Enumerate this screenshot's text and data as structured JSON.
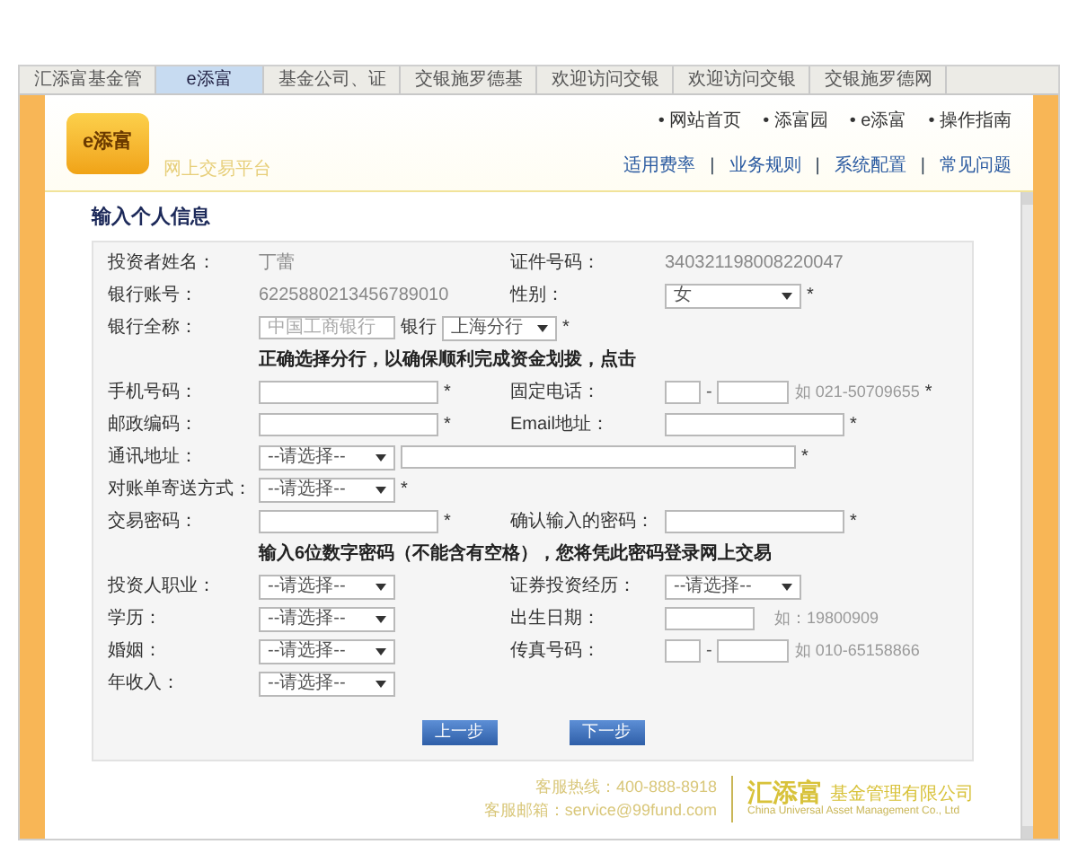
{
  "browser_tabs": [
    {
      "label": "汇添富基金管",
      "selected": false
    },
    {
      "label": "e添富",
      "selected": true
    },
    {
      "label": "基金公司、证",
      "selected": false
    },
    {
      "label": "交银施罗德基",
      "selected": false
    },
    {
      "label": "欢迎访问交银",
      "selected": false
    },
    {
      "label": "欢迎访问交银",
      "selected": false
    },
    {
      "label": "交银施罗德网",
      "selected": false
    }
  ],
  "header": {
    "logo": "e添富",
    "subtitle": "网上交易平台",
    "nav": [
      "• 网站首页",
      "• 添富园",
      "• e添富",
      "• 操作指南"
    ],
    "links": [
      {
        "kind": "link",
        "text": "适用费率"
      },
      {
        "kind": "sep",
        "text": "|"
      },
      {
        "kind": "link",
        "text": "业务规则"
      },
      {
        "kind": "sep",
        "text": "|"
      },
      {
        "kind": "link",
        "text": "系统配置"
      },
      {
        "kind": "sep",
        "text": "|"
      },
      {
        "kind": "link",
        "text": "常见问题"
      }
    ]
  },
  "form": {
    "title": "输入个人信息",
    "rows": [
      {
        "kind": "pair",
        "left": {
          "label": "投资者姓名：",
          "control": {
            "kind": "text",
            "value": "丁蕾"
          }
        },
        "right": {
          "label": "证件号码：",
          "control": {
            "kind": "text",
            "value": "340321198008220047"
          }
        }
      },
      {
        "kind": "pair",
        "left": {
          "label": "银行账号：",
          "control": {
            "kind": "text",
            "value": "6225880213456789010"
          }
        },
        "right": {
          "label": "性别：",
          "control": {
            "kind": "select",
            "value": "女"
          },
          "star": "*"
        }
      },
      {
        "kind": "wide",
        "field": {
          "label": "银行全称：",
          "control": {
            "kind": "bank",
            "placeholder": "中国工商银行",
            "text": "银行",
            "value": "上海分行"
          },
          "star": "*"
        }
      },
      {
        "kind": "note",
        "text": "正确选择分行，以确保顺利完成资金划拨，点击"
      },
      {
        "kind": "pair",
        "left": {
          "label": "手机号码：",
          "control": {
            "kind": "input"
          },
          "star": "*"
        },
        "right": {
          "label": "固定电话：",
          "control": {
            "kind": "phone",
            "separator": "-",
            "hint": "如 021-50709655"
          },
          "star": "*"
        }
      },
      {
        "kind": "pair",
        "left": {
          "label": "邮政编码：",
          "control": {
            "kind": "input"
          },
          "star": "*"
        },
        "right": {
          "label": "Email地址：",
          "control": {
            "kind": "input"
          },
          "star": "*"
        }
      },
      {
        "kind": "wide",
        "field": {
          "label": "通讯地址：",
          "control": {
            "kind": "address",
            "value": "--请选择--"
          },
          "star": "*"
        }
      },
      {
        "kind": "wide",
        "field": {
          "label": "对账单寄送方式：",
          "control": {
            "kind": "select_short",
            "value": "--请选择--"
          },
          "star": "*"
        }
      },
      {
        "kind": "pair",
        "left": {
          "label": "交易密码：",
          "control": {
            "kind": "input"
          },
          "star": "*"
        },
        "right": {
          "label": "确认输入的密码：",
          "control": {
            "kind": "input"
          },
          "star": "*"
        }
      },
      {
        "kind": "note",
        "text": "输入6位数字密码（不能含有空格），您将凭此密码登录网上交易"
      },
      {
        "kind": "pair",
        "left": {
          "label": "投资人职业：",
          "control": {
            "kind": "select_short",
            "value": "--请选择--"
          }
        },
        "right": {
          "label": "证券投资经历：",
          "control": {
            "kind": "select_short",
            "value": "--请选择--"
          }
        }
      },
      {
        "kind": "pair",
        "left": {
          "label": "学历：",
          "control": {
            "kind": "select_short",
            "value": "--请选择--"
          }
        },
        "right": {
          "label": "出生日期：",
          "control": {
            "kind": "date",
            "hint": "如：19800909"
          }
        }
      },
      {
        "kind": "pair",
        "left": {
          "label": "婚姻：",
          "control": {
            "kind": "select_short",
            "value": "--请选择--"
          }
        },
        "right": {
          "label": "传真号码：",
          "control": {
            "kind": "phone",
            "separator": "-",
            "hint": "如 010-65158866"
          }
        }
      },
      {
        "kind": "wide",
        "field": {
          "label": "年收入：",
          "control": {
            "kind": "select_short",
            "value": "--请选择--"
          }
        }
      }
    ],
    "buttons": [
      "上一步",
      "下一步"
    ]
  },
  "footer": {
    "hotline": "客服热线：400-888-8918",
    "email": "客服邮箱：service@99fund.com",
    "company": "汇添富",
    "company_suffix": "基金管理有限公司",
    "company_en": "China Universal Asset Management Co., Ltd"
  }
}
